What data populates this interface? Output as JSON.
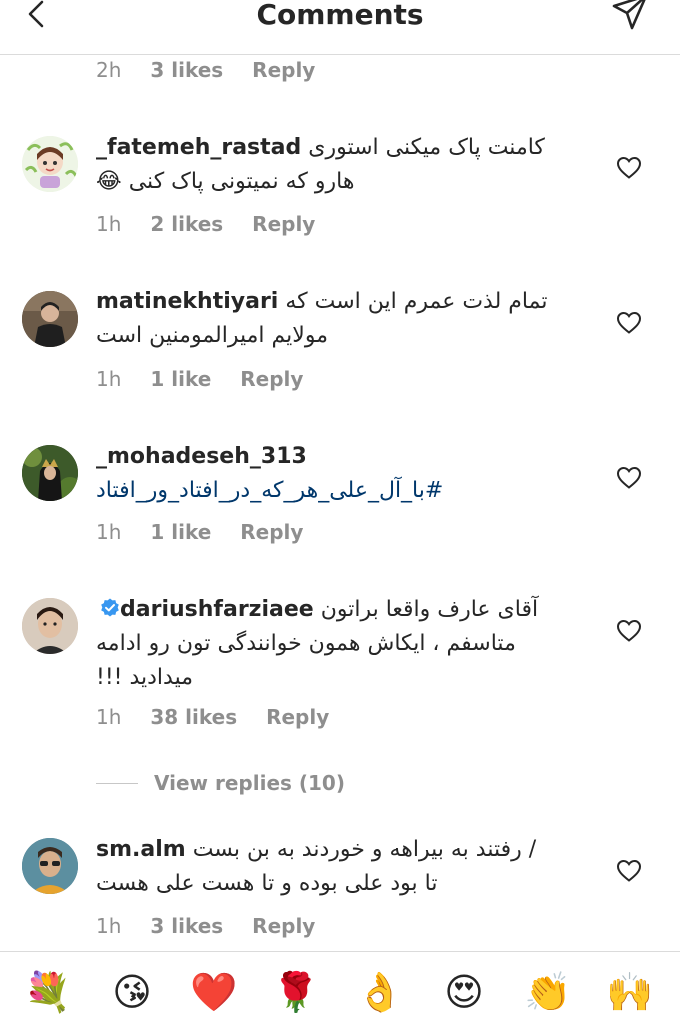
{
  "header": {
    "title": "Comments"
  },
  "top_meta": {
    "time": "2h",
    "likes": "3 likes",
    "reply": "Reply"
  },
  "comments": [
    {
      "user": "_fatemeh_rastad",
      "line1": "کامنت پاک میکنی استوری",
      "line2": "هارو که نمیتونی پاک کنی",
      "emoji": "😂",
      "time": "1h",
      "likes": "2 likes",
      "reply": "Reply"
    },
    {
      "user": "matinekhtiyari",
      "line1": "تمام لذت عمرم این است که",
      "line2": "مولایم امیرالمومنین است",
      "time": "1h",
      "likes": "1 like",
      "reply": "Reply"
    },
    {
      "user": "_mohadeseh_313",
      "hashtag": "#با_آل_علی_هر_که_در_افتاد_ور_افتاد",
      "time": "1h",
      "likes": "1 like",
      "reply": "Reply"
    },
    {
      "user": "dariushfarziaee",
      "line1": "آقای عارف واقعا براتون",
      "line2": "متاسفم ، ایکاش همون خوانندگی تون رو ادامه",
      "line3": "میدادید !!!",
      "time": "1h",
      "likes": "38 likes",
      "reply": "Reply"
    },
    {
      "user": "sm.alm",
      "line1": "/ رفتند به بیراهه و خوردند به بن بست",
      "line2": "تا بود علی بوده و تا هست علی هست",
      "time": "1h",
      "likes": "3 likes",
      "reply": "Reply"
    }
  ],
  "view_replies": "View replies (10)",
  "emoji_bar": [
    "💐",
    "😘",
    "❤️",
    "🌹",
    "👌",
    "😍",
    "👏",
    "🙌"
  ],
  "colors": {
    "link": "#00376b",
    "muted": "#8e8e8e",
    "text": "#262626",
    "verified": "#3897f0",
    "heart_red": "#ed4956"
  }
}
